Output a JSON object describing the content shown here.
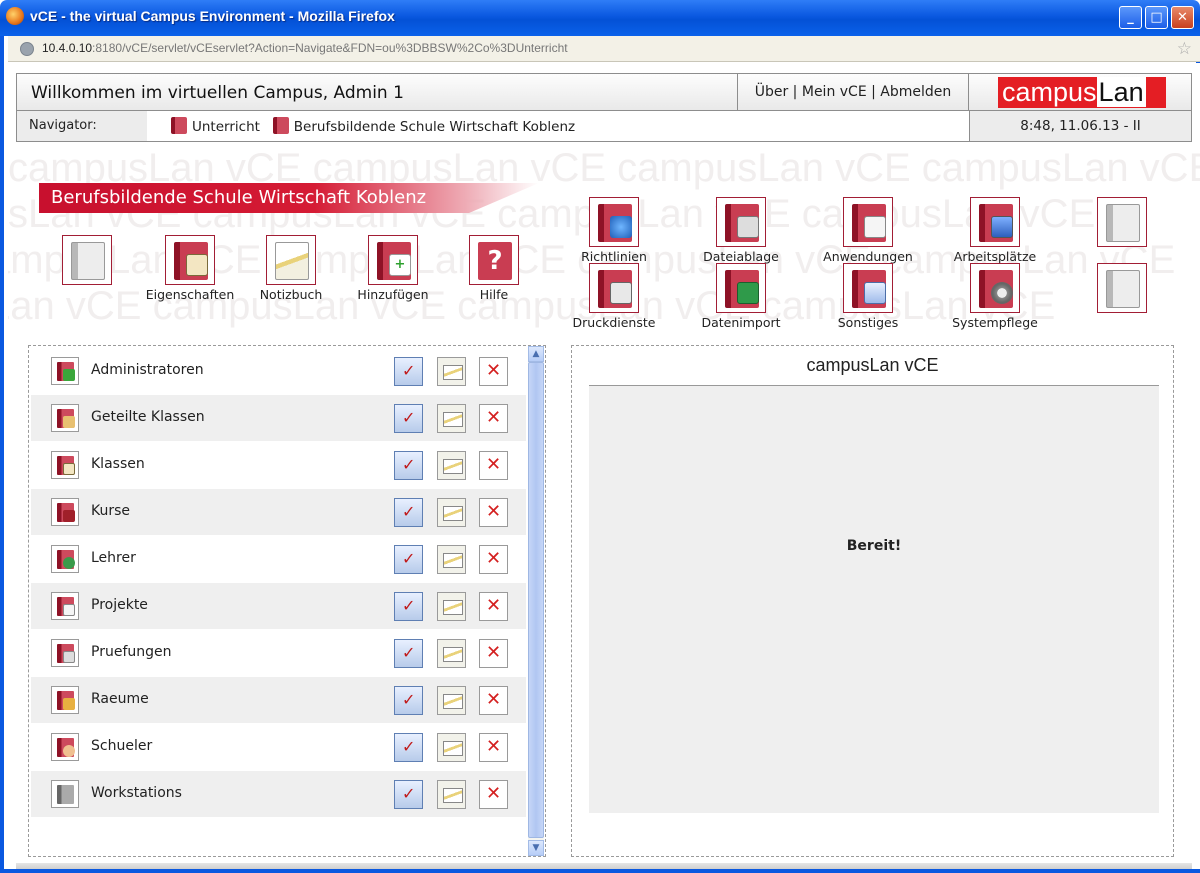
{
  "window": {
    "title": "vCE - the virtual Campus Environment - Mozilla Firefox",
    "minimize": "_",
    "maximize": "□",
    "close": "✕"
  },
  "addressbar": {
    "host": "10.4.0.10",
    "rest": ":8180/vCE/servlet/vCEservlet?Action=Navigate&FDN=ou%3DBBSW%2Co%3DUnterricht",
    "star": "☆"
  },
  "header": {
    "welcome": "Willkommen im virtuellen Campus, Admin 1",
    "links": [
      "Über",
      "Mein vCE",
      "Abmelden"
    ],
    "separator": " | ",
    "logo_campus": "campus",
    "logo_lan": "Lan",
    "brand_red": "#e41e24"
  },
  "navigator": {
    "label": "Navigator:",
    "crumbs": [
      "Unterricht",
      "Berufsbildende Schule Wirtschaft Koblenz"
    ],
    "clock": "8:48, 11.06.13 - II"
  },
  "watermark": "campusLan vCE campusLan vCE campusLan vCE campusLan vCE",
  "banner": "Berufsbildende Schule Wirtschaft Koblenz",
  "toolbar": {
    "left": [
      "",
      "Eigenschaften",
      "Notizbuch",
      "Hinzufügen",
      "Hilfe"
    ],
    "grid_row1": [
      "Richtlinien",
      "Dateiablage",
      "Anwendungen",
      "Arbeitsplätze",
      ""
    ],
    "grid_row2": [
      "Druckdienste",
      "Datenimport",
      "Sonstiges",
      "Systempflege",
      ""
    ]
  },
  "list": {
    "items": [
      "Administratoren",
      "Geteilte Klassen",
      "Klassen",
      "Kurse",
      "Lehrer",
      "Projekte",
      "Pruefungen",
      "Raeume",
      "Schueler",
      "Workstations"
    ]
  },
  "panel": {
    "title": "campusLan vCE",
    "status": "Bereit!"
  }
}
